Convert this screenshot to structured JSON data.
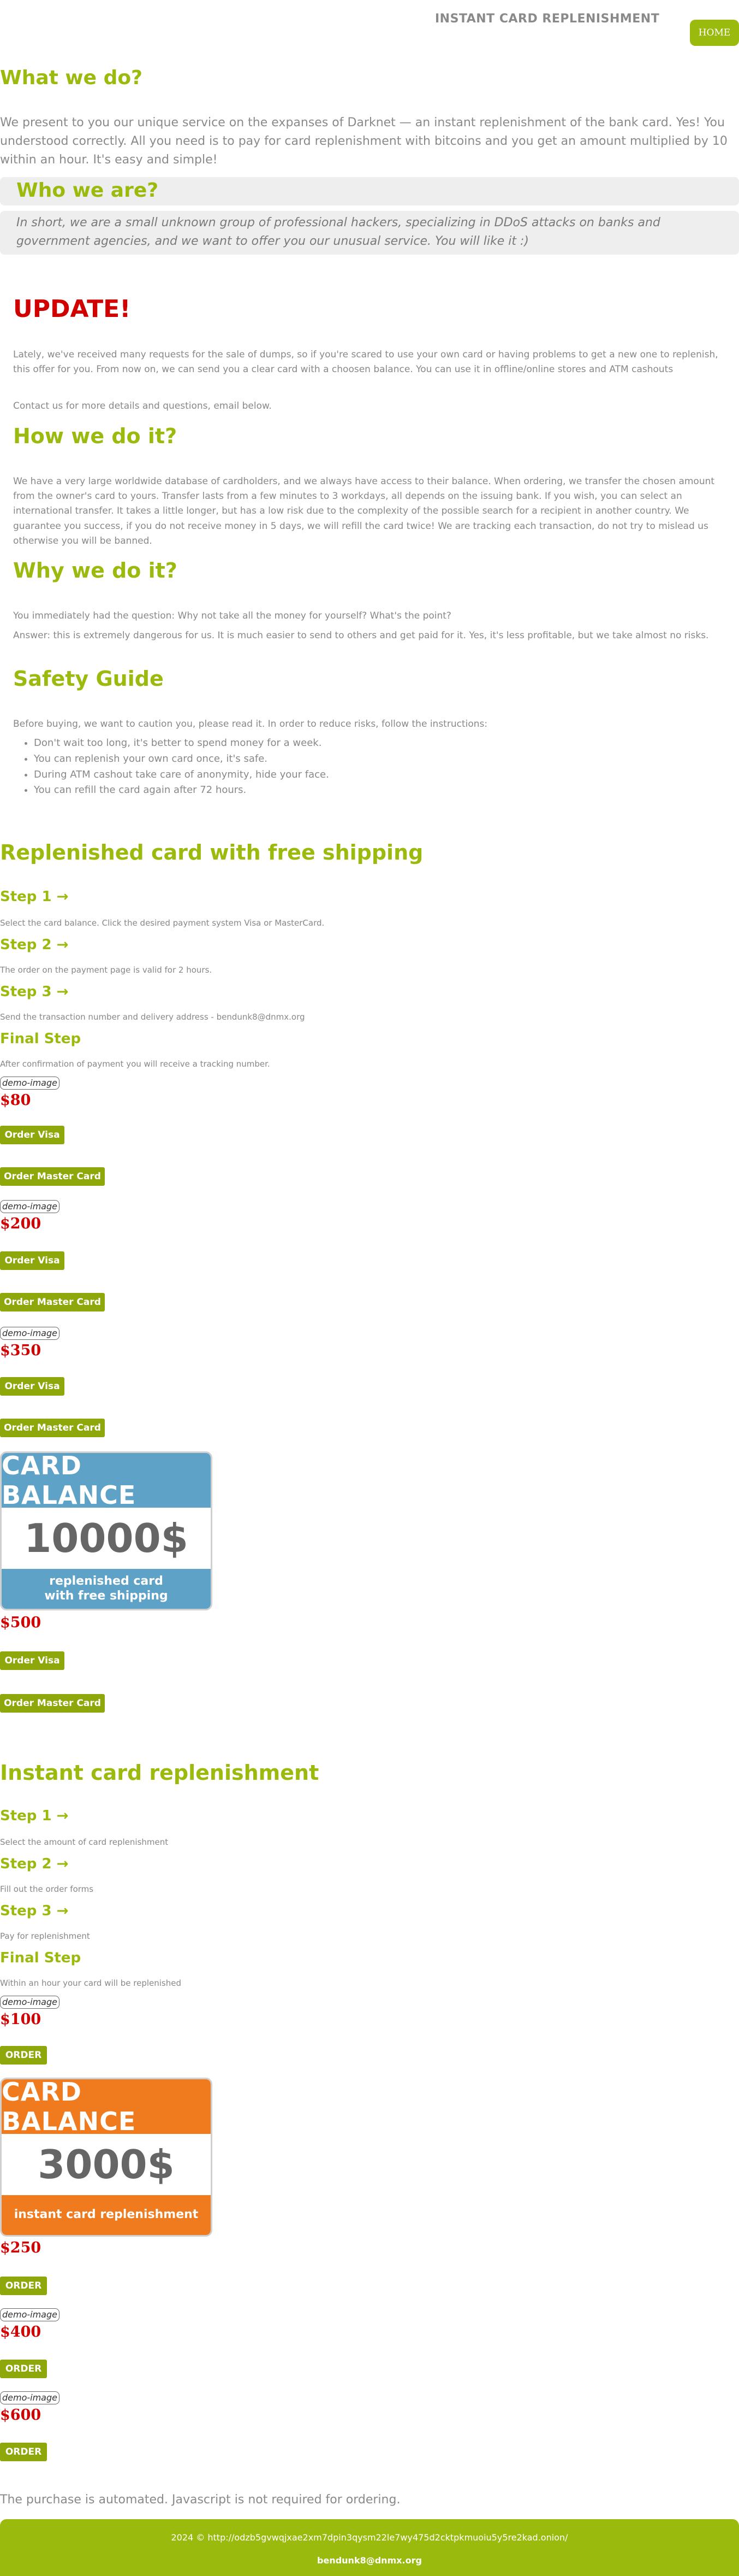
{
  "header": {
    "title": "INSTANT CARD REPLENISHMENT",
    "home_label": "HOME"
  },
  "what": {
    "heading": "What we do?",
    "text": "We present to you our unique service on the expanses of Darknet — an instant replenishment of the bank card. Yes! You understood correctly. All you need is to pay for card replenishment with bitcoins and you get an amount multiplied by 10 within an hour. It's easy and simple!"
  },
  "who": {
    "heading": "Who we are?",
    "text": "In short, we are a small unknown group of professional hackers, specializing in DDoS attacks on banks and government agencies, and we want to offer you our unusual service. You will like it :)"
  },
  "update": {
    "heading": "UPDATE!",
    "text1": "Lately, we've received many requests for the sale of dumps, so if you're scared to use your own card or having problems to get a new one to replenish, this offer for you. From now on, we can send you a clear card with a choosen balance. You can use it in offline/online stores and ATM cashouts",
    "text2": "Contact us for more details and questions, email below."
  },
  "how": {
    "heading": "How we do it?",
    "text": "We have a very large worldwide database of cardholders, and we always have access to their balance. When ordering, we transfer the chosen amount from the owner's card to yours. Transfer lasts from a few minutes to 3 workdays, all depends on the issuing bank. If you wish, you can select an international transfer. It takes a little longer, but has a low risk due to the complexity of the possible search for a recipient in another country. We guarantee you success, if you do not receive money in 5 days, we will refill the card twice! We are tracking each transaction, do not try to mislead us otherwise you will be banned."
  },
  "why": {
    "heading": "Why we do it?",
    "q": "You immediately had the question: Why not take all the money for yourself? What's the point?",
    "a": "Answer: this is extremely dangerous for us. It is much easier to send to others and get paid for it. Yes, it's less profitable, but we take almost no risks."
  },
  "safety": {
    "heading": "Safety Guide",
    "intro": "Before buying, we want to caution you, please read it. In order to reduce risks, follow the instructions:",
    "items": [
      "Don't wait too long, it's better to spend money for a week.",
      "You can replenish your own card once, it's safe.",
      "During ATM cashout take care of anonymity, hide your face.",
      "You can refill the card again after 72 hours."
    ]
  },
  "shipping": {
    "heading": "Replenished card with free shipping",
    "steps": [
      {
        "title": "Step 1 →",
        "text": "Select the card balance. Click the desired payment system Visa or MasterCard."
      },
      {
        "title": "Step 2 →",
        "text": "The order on the payment page is valid for 2 hours."
      },
      {
        "title": "Step 3 →",
        "text": "Send the transaction number and delivery address - bendunk8@dnmx.org"
      },
      {
        "title": "Final Step",
        "text": "After confirmation of payment you will receive a tracking number."
      }
    ],
    "demo_label": "demo-image",
    "visa_label": "Order Visa",
    "master_label": "Order Master Card",
    "prices": [
      "$80",
      "$200",
      "$350",
      "$500"
    ],
    "card": {
      "top": "CARD BALANCE",
      "amount": "10000$",
      "line1": "replenished card",
      "line2": "with free shipping",
      "color": "#5fa2c7"
    }
  },
  "instant": {
    "heading": "Instant card replenishment",
    "steps": [
      {
        "title": "Step 1 →",
        "text": "Select the amount of card replenishment"
      },
      {
        "title": "Step 2 →",
        "text": "Fill out the order forms"
      },
      {
        "title": "Step 3 →",
        "text": "Pay for replenishment"
      },
      {
        "title": "Final Step",
        "text": "Within an hour your card will be replenished"
      }
    ],
    "demo_label": "demo-image",
    "order_label": "ORDER",
    "prices": [
      "$100",
      "$250",
      "$400",
      "$600"
    ],
    "card": {
      "top": "CARD BALANCE",
      "amount": "3000$",
      "line1": "instant card replenishment",
      "color": "#f07a1e"
    }
  },
  "automated": "The purchase is automated. Javascript is not required for ordering.",
  "footer": {
    "copyright": "2024 © http://odzb5gvwqjxae2xm7dpin3qysm22le7wy475d2cktpkmuoiu5y5re2kad.onion/",
    "email": "bendunk8@dnmx.org"
  },
  "colors": {
    "accent": "#9bba0e",
    "button": "#8ea80c",
    "price": "#d10000"
  }
}
